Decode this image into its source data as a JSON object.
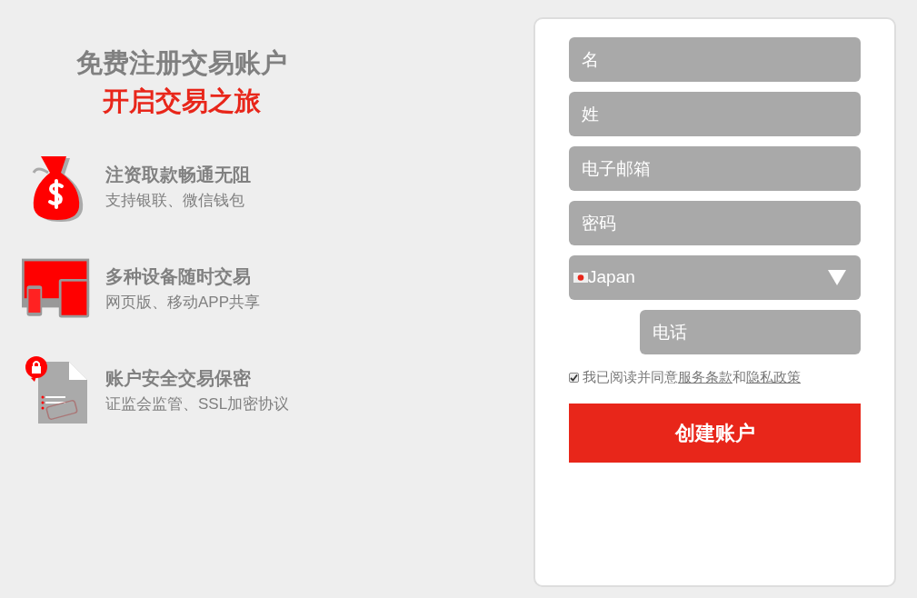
{
  "headline": {
    "line_1": "免费注册交易账户",
    "line_2": "开启交易之旅"
  },
  "features": [
    {
      "title": "注资取款畅通无阻",
      "subtitle": "支持银联、微信钱包"
    },
    {
      "title": "多种设备随时交易",
      "subtitle": "网页版、移动APP共享"
    },
    {
      "title": "账户安全交易保密",
      "subtitle": "证监会监管、SSL加密协议"
    }
  ],
  "form": {
    "fields": [
      {
        "placeholder": "名"
      },
      {
        "placeholder": "姓"
      },
      {
        "placeholder": "电子邮箱"
      },
      {
        "placeholder": "密码"
      }
    ],
    "country": {
      "value": "Japan"
    },
    "phone": {
      "placeholder": "电话"
    },
    "consent": {
      "checked": true,
      "text_1": "我已阅读并同意",
      "terms_link": "服务条款",
      "text_2": "和",
      "privacy_link": "隐私政策"
    },
    "submit": "创建账户"
  }
}
